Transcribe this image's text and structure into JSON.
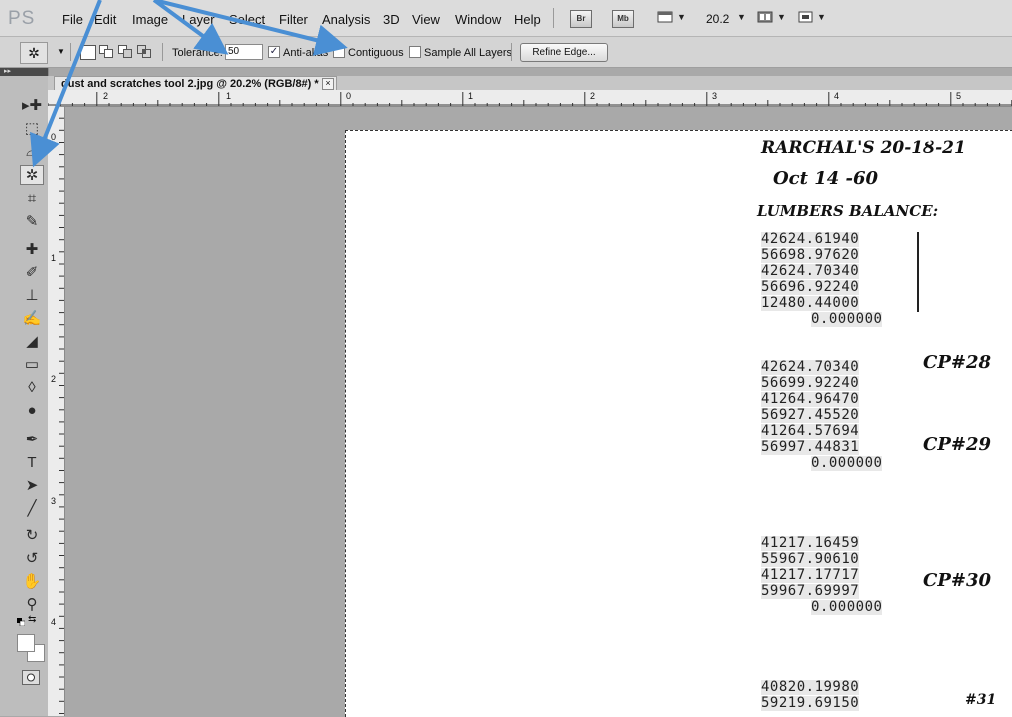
{
  "app": {
    "logo": "PS"
  },
  "menu": [
    "File",
    "Edit",
    "Image",
    "Layer",
    "Select",
    "Filter",
    "Analysis",
    "3D",
    "View",
    "Window",
    "Help"
  ],
  "appbar": {
    "bridge": "Br",
    "minibridge": "Mb",
    "zoom": "20.2"
  },
  "options": {
    "tolerance_label": "Tolerance:",
    "tolerance_value": "50",
    "antialias_label": "Anti-alias",
    "antialias_checked": "✓",
    "contiguous_label": "Contiguous",
    "sample_all_label": "Sample All Layers",
    "refine_edge": "Refine Edge..."
  },
  "document": {
    "tab_title": "dust and scratches tool 2.jpg @ 20.2% (RGB/8#) *",
    "close": "×"
  },
  "rulers": {
    "top": [
      "2",
      "1",
      "0",
      "1",
      "2",
      "3",
      "4",
      "5"
    ],
    "left": [
      "0",
      "1",
      "2",
      "3",
      "4"
    ]
  },
  "scan": {
    "heading": "RARCHAL'S 20-1Ȣ-21",
    "date": "Oct 14 -60",
    "subheading": "LUMBERS BALANCE:",
    "group1": [
      "42624.61940",
      "56698.97620",
      "42624.70340",
      "56696.92240",
      "12480.44000",
      "0.000000"
    ],
    "group2": [
      "42624.70340",
      "56699.92240",
      "41264.96470",
      "56927.45520",
      "41264.57694",
      "56997.44831",
      "0.000000"
    ],
    "group3": [
      "41217.16459",
      "55967.90610",
      "41217.17717",
      "59967.69997",
      "0.000000"
    ],
    "group4": [
      "40820.19980",
      "59219.69150"
    ],
    "note_cp28": "CP#28",
    "note_cp29": "CP#29",
    "note_cp30": "CP#30",
    "note_cp31": "#31"
  },
  "colors": {
    "arrow": "#4a8fd4",
    "menubar": "#dcdcdc",
    "canvas": "#a9a9a9"
  },
  "icons": [
    "move-tool",
    "marquee-tool",
    "lasso-tool",
    "magic-wand-tool",
    "crop-tool",
    "eyedropper-tool",
    "spot-healing-tool",
    "brush-tool",
    "clone-stamp-tool",
    "history-brush-tool",
    "eraser-tool",
    "gradient-tool",
    "blur-tool",
    "dodge-tool",
    "pen-tool",
    "type-tool",
    "path-selection-tool",
    "line-tool",
    "3d-rotate-tool",
    "3d-orbit-tool",
    "hand-tool",
    "zoom-tool",
    "swap-colors-icon",
    "foreground-color",
    "background-color",
    "quick-mask-tool"
  ]
}
